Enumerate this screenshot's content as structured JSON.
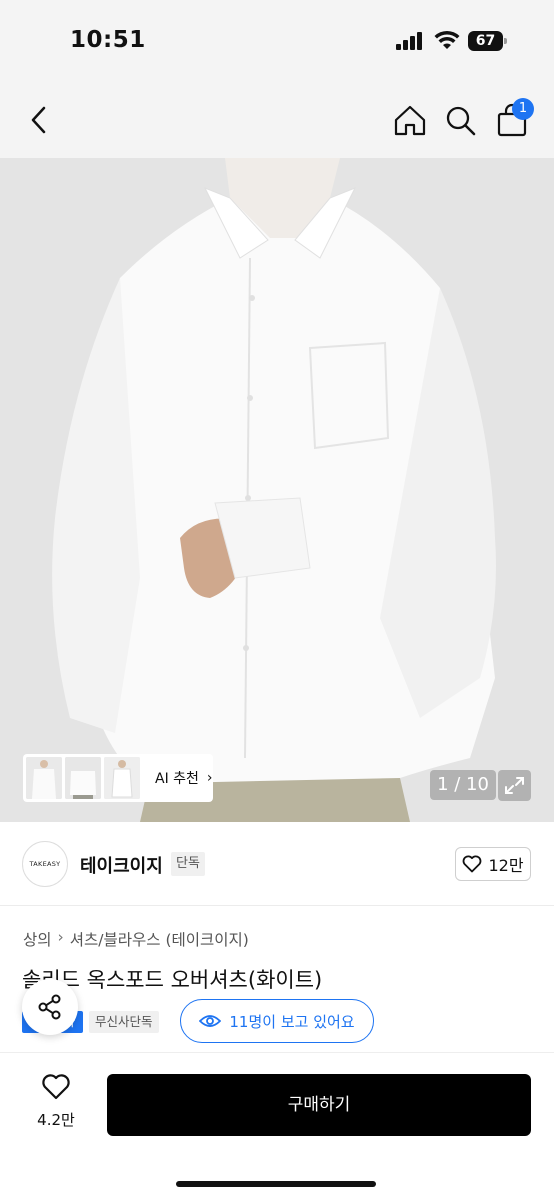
{
  "status_bar": {
    "time": "10:51",
    "battery": "67"
  },
  "header": {
    "back_icon": "chevron-left-icon",
    "home_icon": "home-icon",
    "search_icon": "search-icon",
    "cart_icon": "shopping-bag-icon",
    "cart_badge": "1"
  },
  "gallery": {
    "ai_recommend_label": "AI 추천",
    "page_counter": "1 / 10",
    "expand_icon": "expand-arrows-icon"
  },
  "brand": {
    "logo_text": "TAKEASY",
    "name": "테이크이지",
    "tag": "단독",
    "likes": "12만"
  },
  "breadcrumb": {
    "category": "상의",
    "subcategory": "셔츠/블라우스 (테이크이지)"
  },
  "product": {
    "title": "솔리드 옥스포드 오버셔츠(화이트)",
    "tag_blue": "스타",
    "tag_gray": "무신사단독"
  },
  "viewers": {
    "text": "11명이 보고 있어요"
  },
  "bottom_bar": {
    "wishlist_count": "4.2만",
    "buy_label": "구매하기"
  },
  "colors": {
    "accent": "#1e74f2",
    "buy_button": "#000000"
  }
}
